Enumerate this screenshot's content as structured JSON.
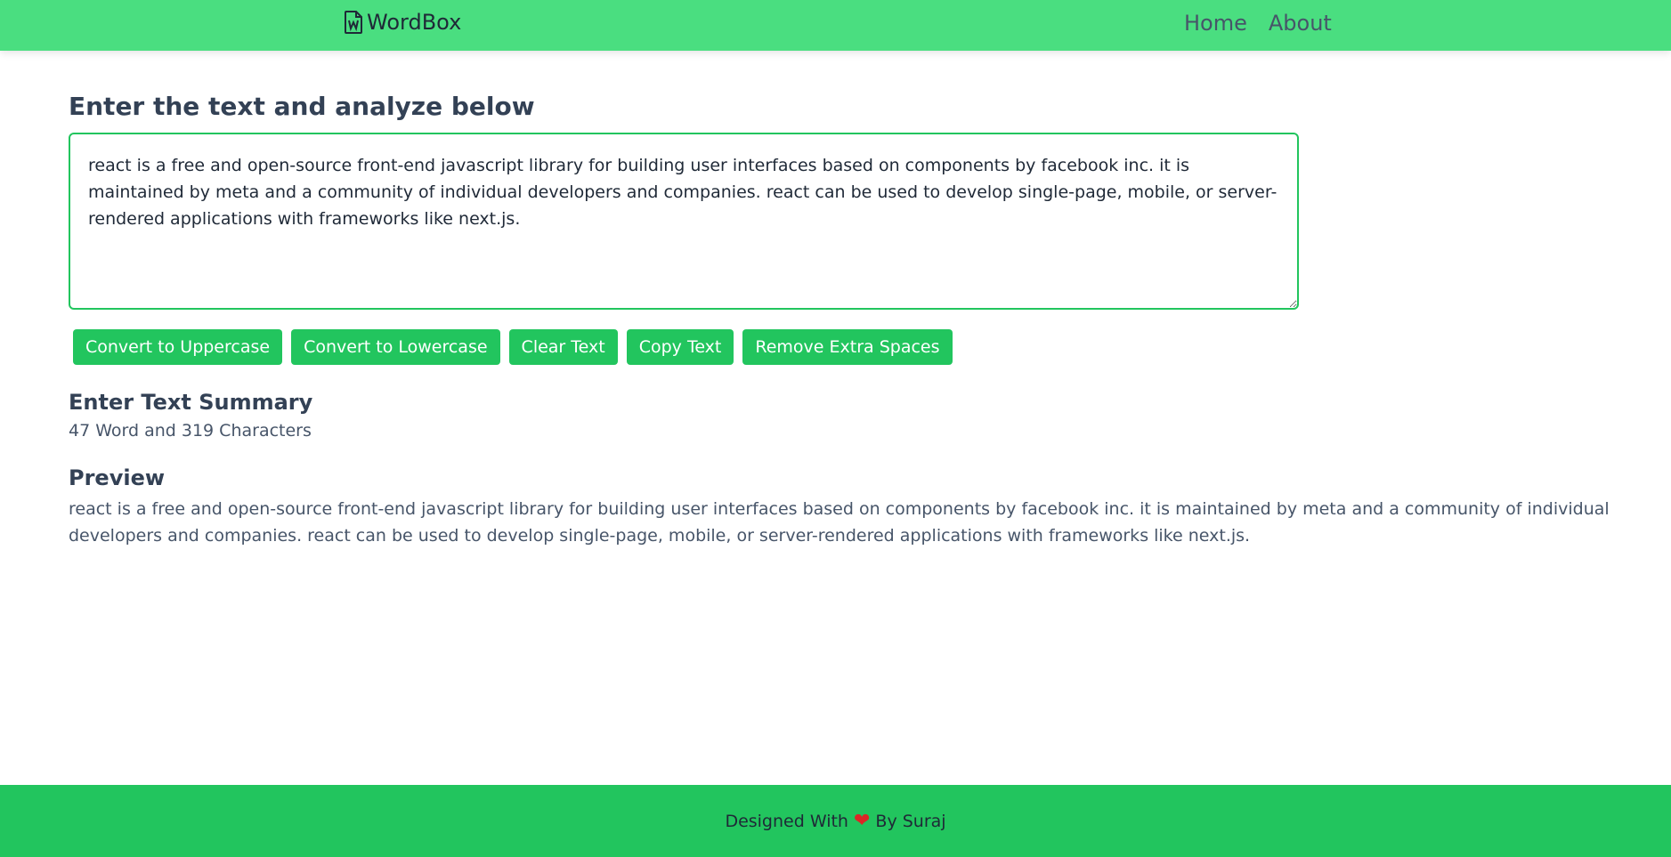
{
  "navbar": {
    "brand": "WordBox",
    "brand_icon": "word-file-icon",
    "links": [
      "Home",
      "About"
    ],
    "color": "#4ade80"
  },
  "main": {
    "heading": "Enter the text and analyze below",
    "textarea_value": "react is a free and open-source front-end javascript library for building user interfaces based on components by facebook inc. it is maintained by meta and a community of individual developers and companies. react can be used to develop single-page, mobile, or server-rendered applications with frameworks like next.js.",
    "buttons": [
      "Convert to Uppercase",
      "Convert to Lowercase",
      "Clear Text",
      "Copy Text",
      "Remove Extra Spaces"
    ],
    "accent_color": "#22c55e",
    "summary_title": "Enter Text Summary",
    "summary_text": "47 Word and 319 Characters",
    "preview_title": "Preview",
    "preview_text": "react is a free and open-source front-end javascript library for building user interfaces based on components by facebook inc. it is maintained by meta and a community of individual developers and companies. react can be used to develop single-page, mobile, or server-rendered applications with frameworks like next.js."
  },
  "footer": {
    "prefix": "Designed With",
    "icon": "heart-icon",
    "suffix": "By Suraj",
    "heart_color": "#dc2626"
  }
}
